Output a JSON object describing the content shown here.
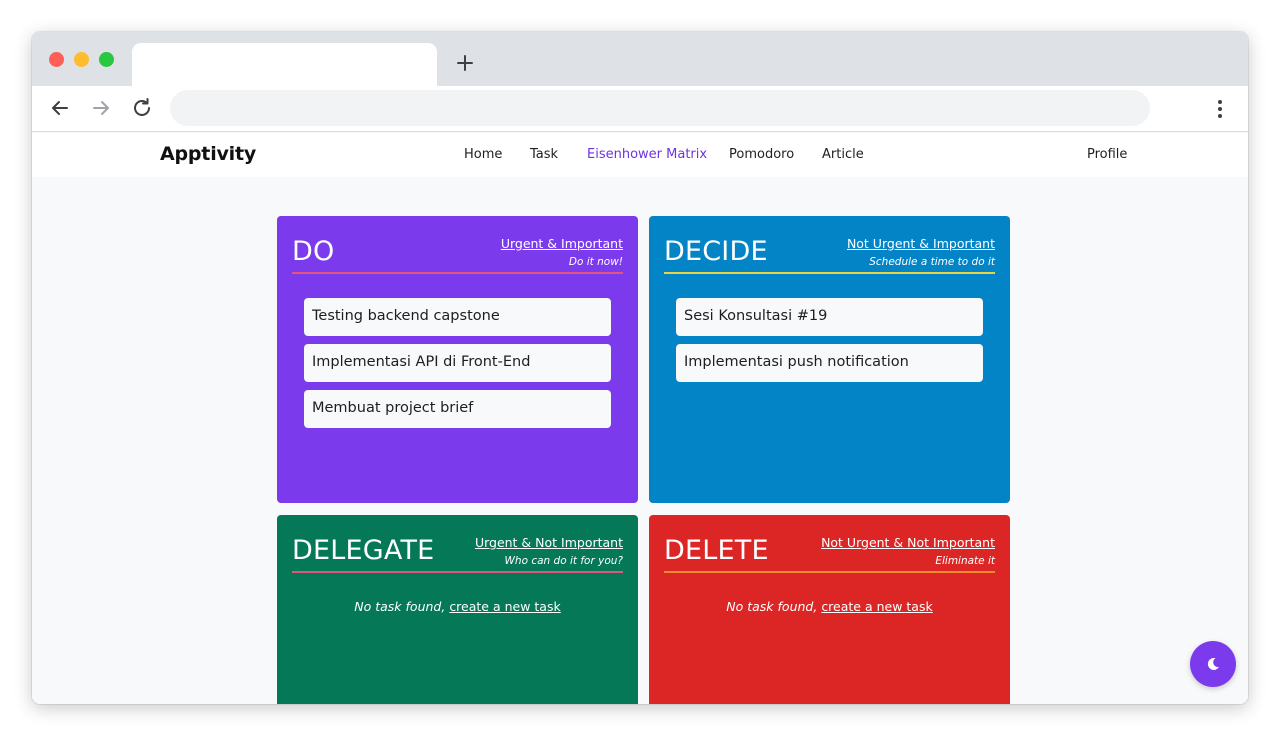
{
  "app": {
    "logo": "Apptivity",
    "nav": {
      "home": "Home",
      "task": "Task",
      "matrix": "Eisenhower Matrix",
      "pomodoro": "Pomodoro",
      "article": "Article",
      "profile": "Profile"
    },
    "active_nav": "Eisenhower Matrix"
  },
  "browser": {
    "new_tab_icon": "plus-icon",
    "back_icon": "arrow-left-icon",
    "forward_icon": "arrow-right-icon",
    "reload_icon": "reload-icon",
    "menu_icon": "kebab-menu-icon"
  },
  "matrix": {
    "do": {
      "title": "DO",
      "label": "Urgent & Important",
      "subtitle": "Do it now!",
      "color": "#7c3aed",
      "line_color": "#e2567c",
      "tasks": [
        "Testing backend capstone",
        "Implementasi API di Front-End",
        "Membuat project brief"
      ]
    },
    "decide": {
      "title": "DECIDE",
      "label": "Not Urgent & Important",
      "subtitle": "Schedule a time to do it",
      "color": "#0284c7",
      "line_color": "#e7d547",
      "tasks": [
        "Sesi Konsultasi #19",
        "Implementasi push notification"
      ]
    },
    "delegate": {
      "title": "DELEGATE",
      "label": "Urgent & Not Important",
      "subtitle": "Who can do it for you?",
      "color": "#047857",
      "line_color": "#e2567c",
      "empty_text": "No task found,",
      "empty_link": "create a new task"
    },
    "delete": {
      "title": "DELETE",
      "label": "Not Urgent & Not Important",
      "subtitle": "Eliminate it",
      "color": "#dc2626",
      "line_color": "#f38a2d",
      "empty_text": "No task found,",
      "empty_link": "create a new task"
    }
  },
  "fab": {
    "icon": "moon-icon",
    "color": "#7c3aed"
  }
}
